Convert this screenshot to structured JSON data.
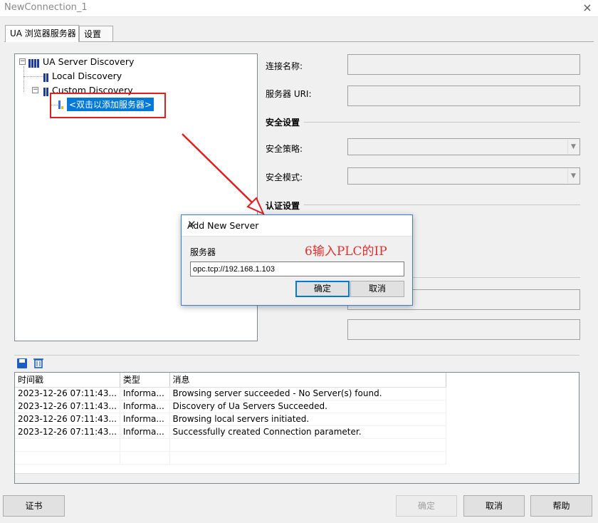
{
  "window": {
    "title": "NewConnection_1",
    "close_glyph": "×"
  },
  "tabs": [
    {
      "label": "UA 浏览器服务器"
    },
    {
      "label": "设置"
    }
  ],
  "tree": {
    "root": "UA Server Discovery",
    "local": "Local Discovery",
    "custom": "Custom Discovery",
    "add_placeholder": "<双击以添加服务器>"
  },
  "fields": {
    "conn_name_label": "连接名称:",
    "server_uri_label": "服务器 URI:",
    "security_section": "安全设置",
    "policy_label": "安全策略:",
    "mode_label": "安全模式:",
    "auth_section": "认证设置"
  },
  "log": {
    "columns": [
      "时间戳",
      "类型",
      "消息"
    ],
    "rows": [
      [
        "2023-12-26 07:11:43...",
        "Informa...",
        "Browsing server succeeded - No Server(s) found."
      ],
      [
        "2023-12-26 07:11:43...",
        "Informa...",
        "Discovery of Ua Servers Succeeded."
      ],
      [
        "2023-12-26 07:11:43...",
        "Informa...",
        "Browsing local servers initiated."
      ],
      [
        "2023-12-26 07:11:43...",
        "Informa...",
        "Successfully created Connection parameter."
      ]
    ]
  },
  "buttons": {
    "cert": "证书",
    "ok": "确定",
    "cancel": "取消",
    "help": "帮助"
  },
  "dialog": {
    "title": "Add New Server",
    "close_glyph": "✕",
    "label": "服务器",
    "annotation": "6输入PLC的IP",
    "input_value": "opc.tcp://192.168.1.103",
    "ok": "确定",
    "cancel": "取消"
  },
  "colors": {
    "accent": "#0078d7",
    "annotation": "#e02020"
  }
}
